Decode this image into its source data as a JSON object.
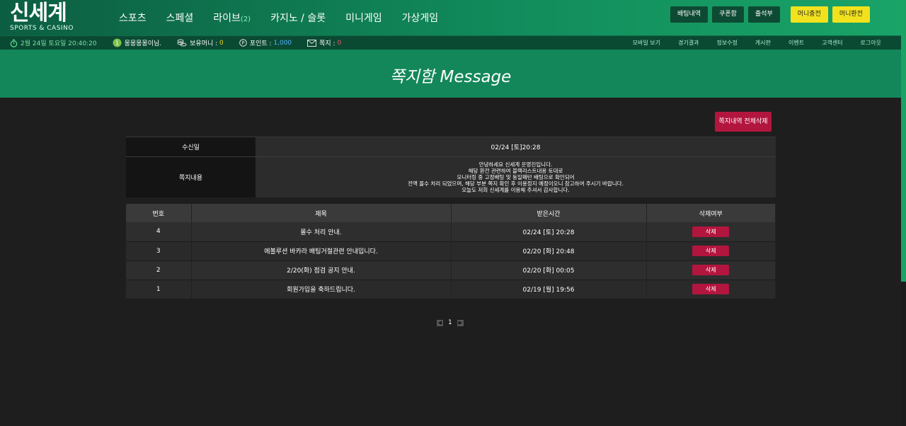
{
  "brand": {
    "logo_main": "신세계",
    "logo_sub": "SPORTS & CASINO"
  },
  "nav": [
    {
      "label": "스포츠"
    },
    {
      "label": "스페셜"
    },
    {
      "label": "라이브",
      "count": "(2)"
    },
    {
      "label": "카지노 / 슬롯"
    },
    {
      "label": "미니게임"
    },
    {
      "label": "가상게임"
    }
  ],
  "header_buttons": [
    "배팅내역",
    "쿠폰함",
    "출석부"
  ],
  "money_buttons": [
    "머니충전",
    "머니환전"
  ],
  "subbar": {
    "datetime": "2월 24일 토요일 20:40:20",
    "user": "몽몽몽몽이님.",
    "money_label": "보유머니 :",
    "money_value": "0",
    "point_label": "포인트 :",
    "point_value": "1,000",
    "note_label": "쪽지 :",
    "note_value": "0",
    "links": [
      "모바일 보기",
      "경기결과",
      "정보수정",
      "게시판",
      "이벤트",
      "고객센터",
      "로그아웃"
    ]
  },
  "page_title": "쪽지함 Message",
  "delete_all_label": "쪽지내역 전체삭제",
  "detail": {
    "received_label": "수신일",
    "received_value": "02/24 [토]20:28",
    "content_label": "쪽지내용",
    "content_lines": [
      "안녕하세요 신세계 운영진입니다.",
      "해당 환전 관련하여 블랙리스트내용 토대로",
      "모니터링 중 고정배팅 및 동일패턴 배팅으로 확인되어",
      "전액 몰수 처리 되었으며, 해당 부분 쪽지 확인 후 이용정지 예정이오니 참고하여 주시기 바랍니다.",
      "오늘도 저희 신세계를 이용해 주셔서 감사합니다."
    ]
  },
  "list": {
    "headers": [
      "번호",
      "제목",
      "받은시간",
      "삭제여부"
    ],
    "rows": [
      {
        "no": "4",
        "title": "몰수 처리 안내.",
        "time": "02/24 [토] 20:28",
        "del": "삭제"
      },
      {
        "no": "3",
        "title": "에볼루션 바카라 배팅거절관련 안내입니다.",
        "time": "02/20 [화] 20:48",
        "del": "삭제"
      },
      {
        "no": "2",
        "title": "2/20(화) 점검 공지 안내.",
        "time": "02/20 [화] 00:05",
        "del": "삭제"
      },
      {
        "no": "1",
        "title": "회원가입을 축하드립니다.",
        "time": "02/19 [월] 19:56",
        "del": "삭제"
      }
    ]
  },
  "pager": {
    "current": "1"
  },
  "colors": {
    "header_green": "#118b5b",
    "banner_green": "#13875a",
    "accent_red": "#b2163f",
    "yellow_button": "#f2e21e"
  }
}
